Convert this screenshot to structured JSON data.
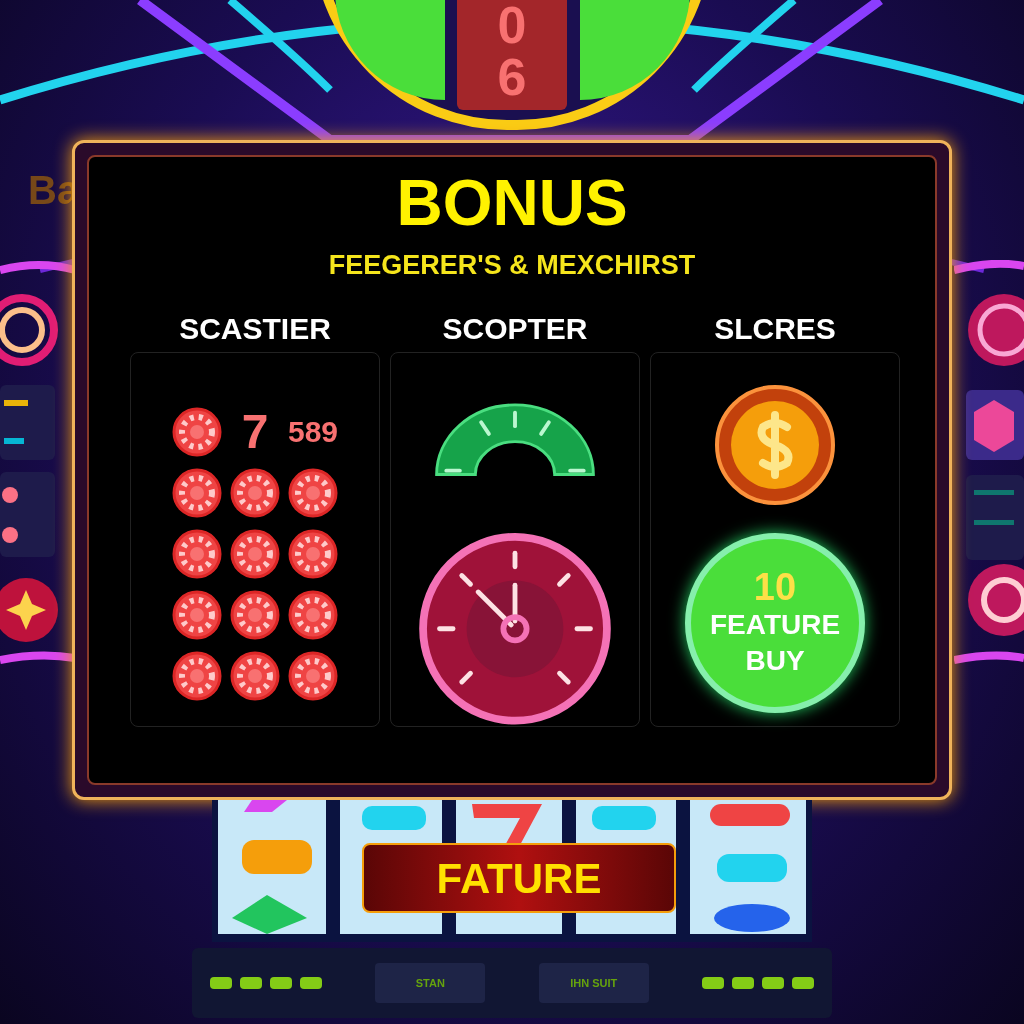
{
  "top_sign": {
    "digits": [
      "0",
      "6"
    ]
  },
  "side_label": "Ba",
  "panel": {
    "title": "BONUS",
    "subtitle": "FEEGERER'S & MEXCHIRST",
    "columns": [
      {
        "heading": "SCASTIER",
        "kind": "chip_grid",
        "rows": [
          [
            {
              "kind": "chip"
            },
            {
              "kind": "text",
              "text": "7"
            },
            {
              "kind": "text",
              "text": "589"
            }
          ],
          [
            {
              "kind": "chip"
            },
            {
              "kind": "chip"
            },
            {
              "kind": "chip"
            }
          ],
          [
            {
              "kind": "chip"
            },
            {
              "kind": "chip"
            },
            {
              "kind": "chip"
            }
          ],
          [
            {
              "kind": "chip"
            },
            {
              "kind": "chip"
            },
            {
              "kind": "chip"
            }
          ],
          [
            {
              "kind": "chip"
            },
            {
              "kind": "chip"
            },
            {
              "kind": "chip"
            }
          ]
        ]
      },
      {
        "heading": "SCOPTER",
        "kind": "gauges"
      },
      {
        "heading": "SLCRES",
        "kind": "feature_buy",
        "count": "10",
        "button": "FEATURE BUY"
      }
    ]
  },
  "banner_button": "FATURE",
  "controls": [
    {
      "label": "STAN"
    },
    {
      "label": "IHN SUIT"
    }
  ]
}
